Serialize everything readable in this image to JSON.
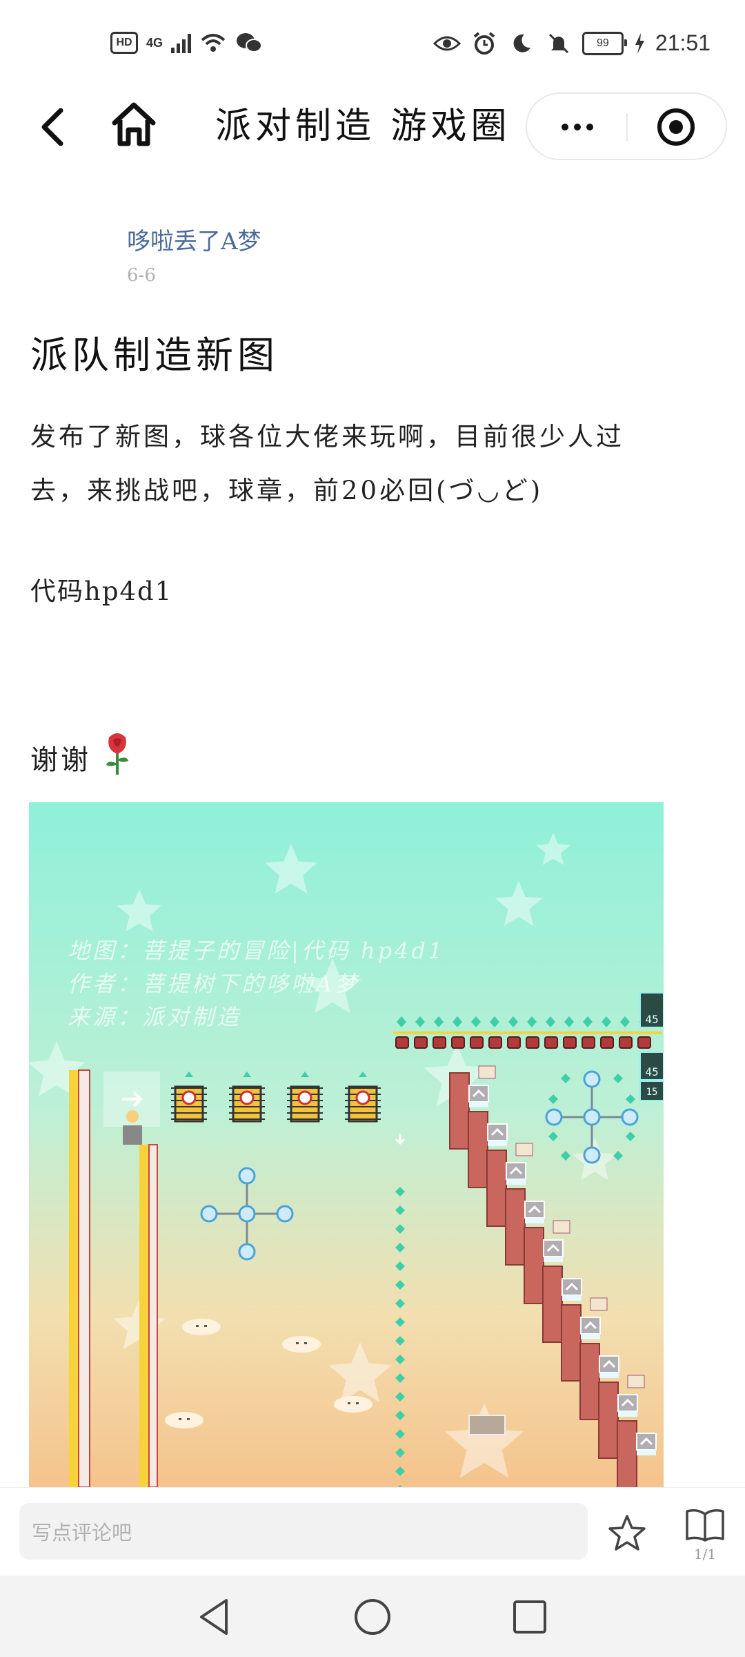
{
  "status_bar": {
    "hd": "HD",
    "network": "4G",
    "battery": "99",
    "time": "21:51",
    "icons": [
      "hd-icon",
      "signal-icon",
      "wifi-icon",
      "wechat-icon",
      "eye-icon",
      "alarm-icon",
      "moon-icon",
      "mute-icon",
      "battery-icon",
      "charging-icon"
    ]
  },
  "nav": {
    "title": "派对制造 游戏圈",
    "icons": [
      "back-icon",
      "home-icon",
      "more-icon",
      "target-icon"
    ]
  },
  "post": {
    "author": "哆啦丢了A梦",
    "date": "6-6",
    "title": "派队制造新图",
    "body": "发布了新图，球各位大佬来玩啊，目前很少人过去，来挑战吧，球章，前20必回(づ◡ど)",
    "code_line": "代码hp4d1",
    "thanks": "谢谢",
    "thanks_emoji": "🌹"
  },
  "image": {
    "watermark": [
      "地图：菩提子的冒险|代码 hp4d1",
      "作者：菩提树下的哆啦A梦",
      "来源：派对制造"
    ],
    "counter_a": "45",
    "counter_b": "45",
    "counter_c": "15",
    "colors": {
      "sky_top": "#8ff0d8",
      "sky_bottom": "#f5c38c",
      "brick": "#c9675e",
      "gem": "#3fcfa8",
      "rope": "#f6d23b"
    }
  },
  "comment_bar": {
    "placeholder": "写点评论吧",
    "page": "1/1",
    "icons": [
      "star-icon",
      "book-icon"
    ]
  },
  "system_nav": {
    "icons": [
      "nav-back-icon",
      "nav-home-icon",
      "nav-recents-icon"
    ]
  }
}
